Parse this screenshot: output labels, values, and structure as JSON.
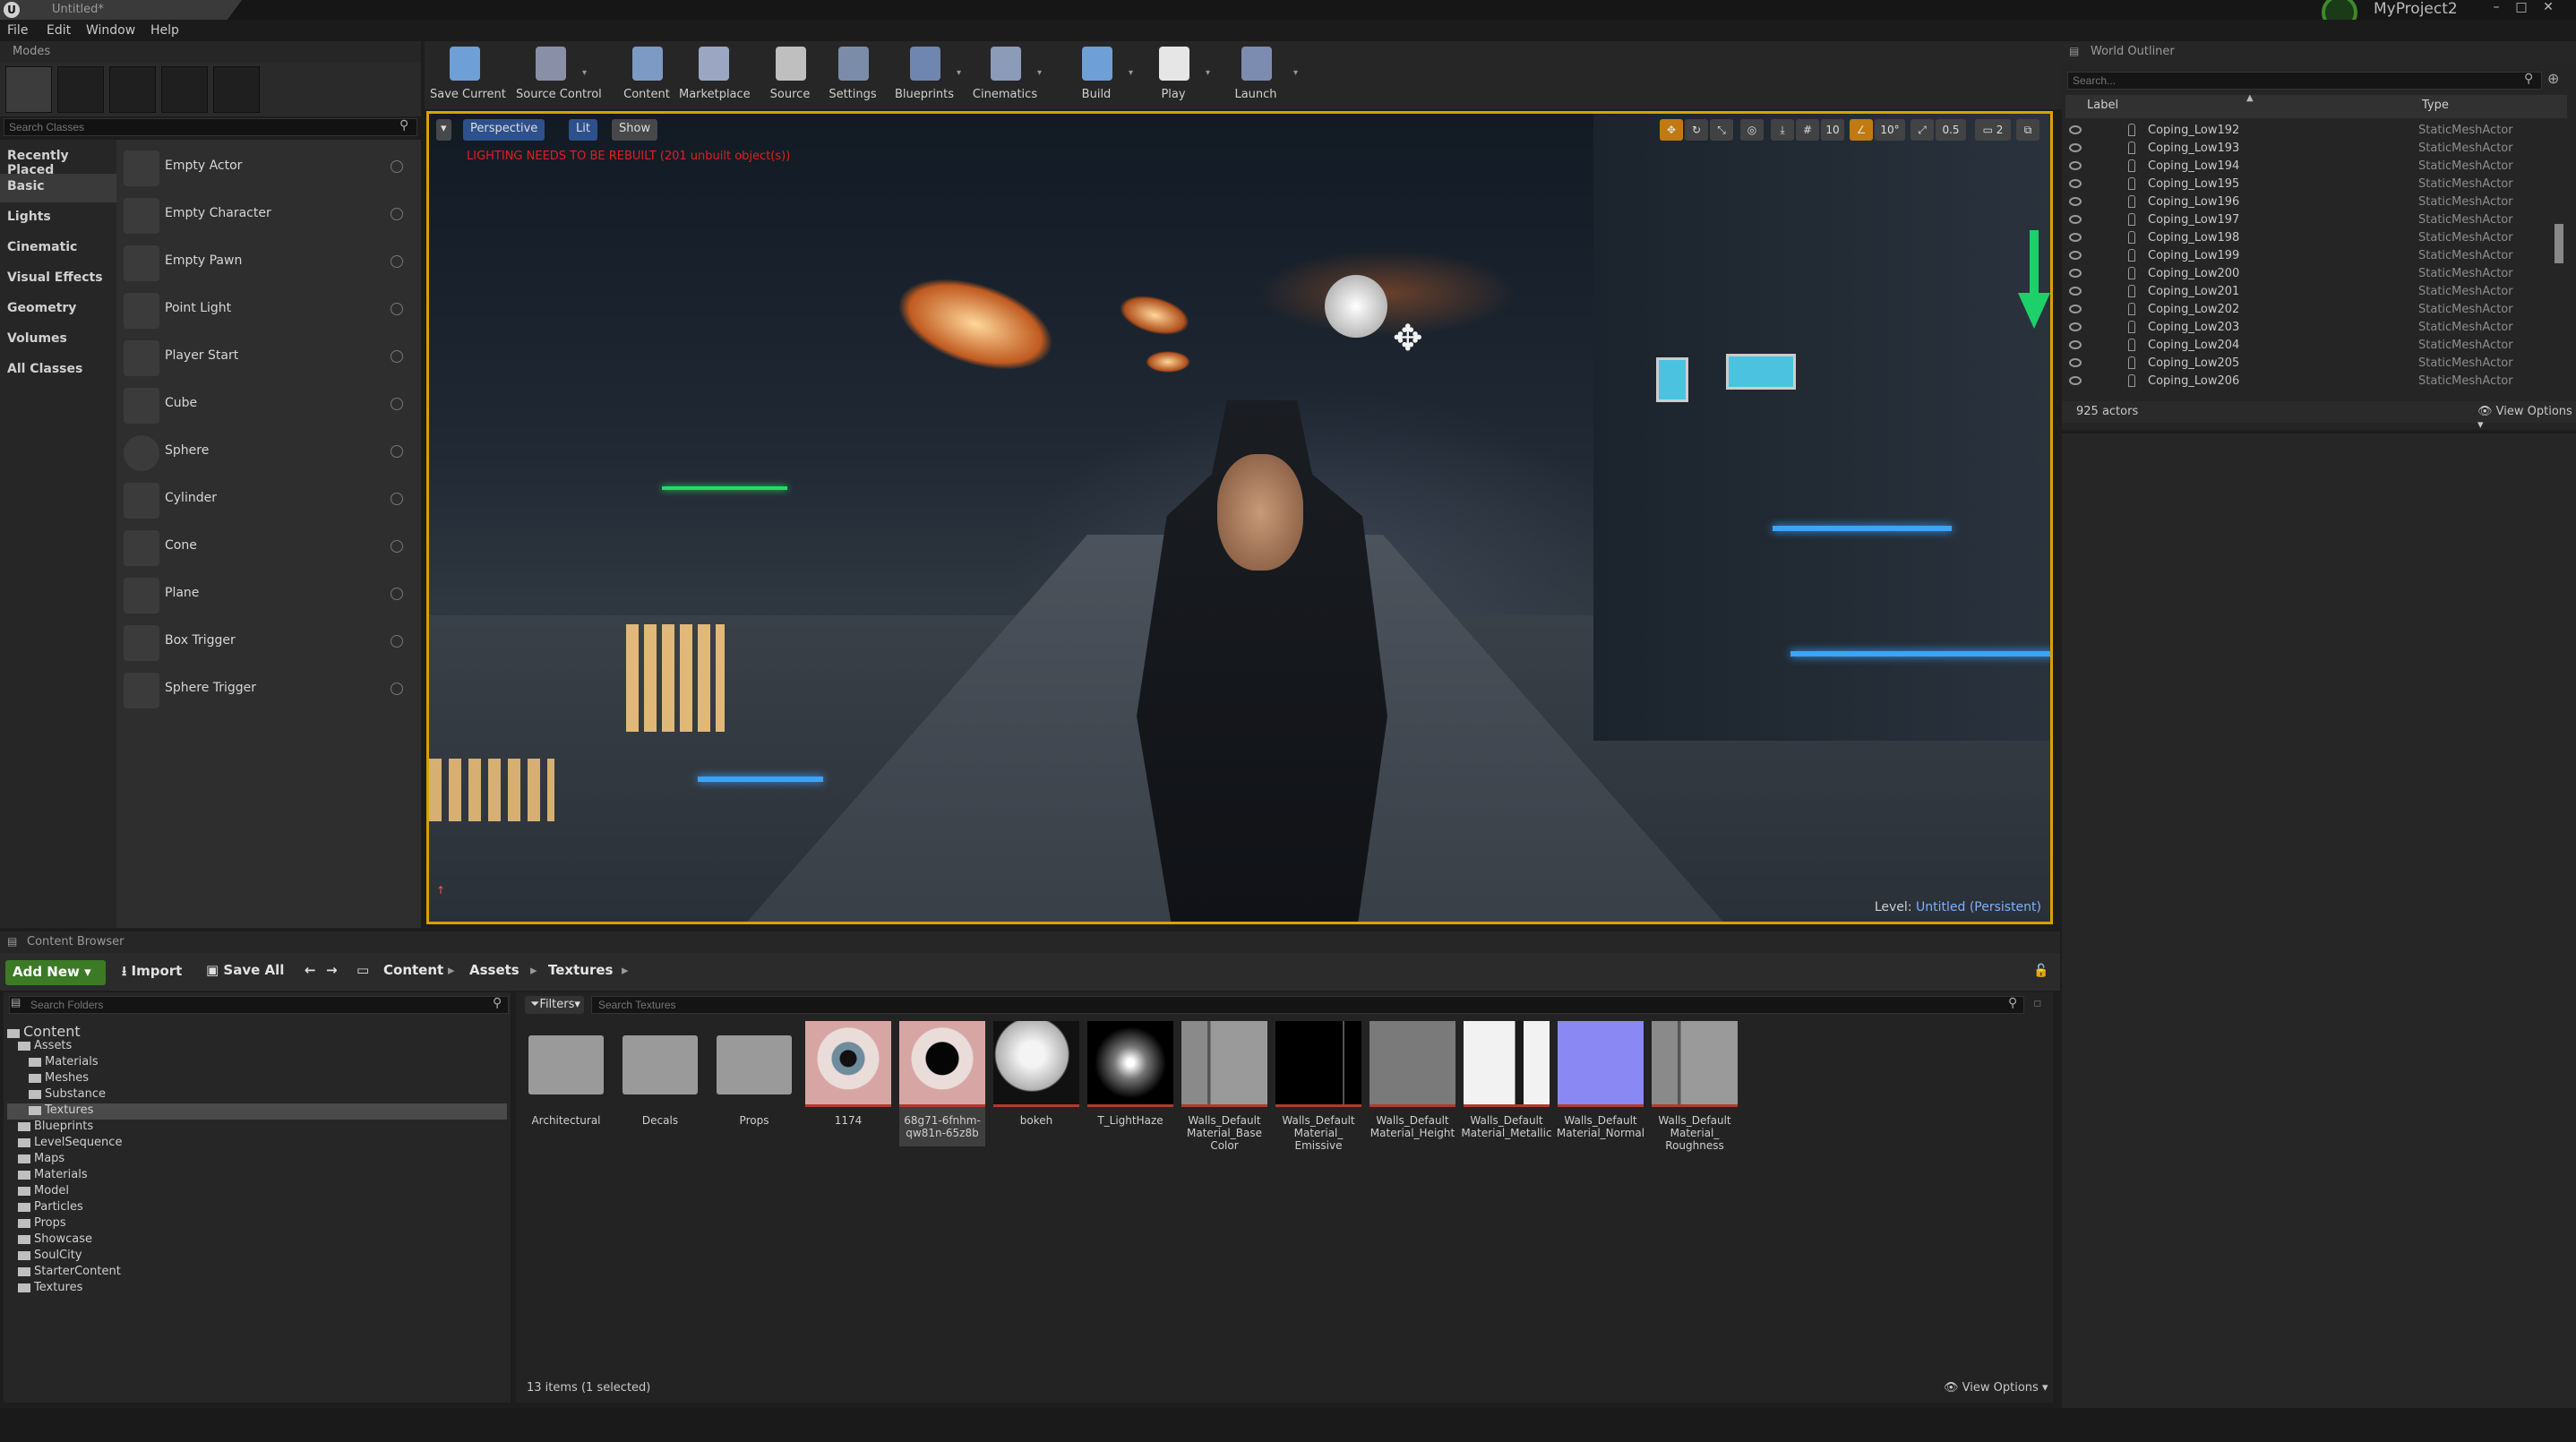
{
  "titlebar": {
    "doc_tab": "Untitled*",
    "project": "MyProject2"
  },
  "menu": [
    "File",
    "Edit",
    "Window",
    "Help"
  ],
  "modes": {
    "tab": "Modes",
    "search_placeholder": "Search Classes",
    "categories": [
      "Recently Placed",
      "Basic",
      "Lights",
      "Cinematic",
      "Visual Effects",
      "Geometry",
      "Volumes",
      "All Classes"
    ],
    "selected_category": "Basic",
    "items": [
      "Empty Actor",
      "Empty Character",
      "Empty Pawn",
      "Point Light",
      "Player Start",
      "Cube",
      "Sphere",
      "Cylinder",
      "Cone",
      "Plane",
      "Box Trigger",
      "Sphere Trigger"
    ]
  },
  "toolbar": [
    {
      "label": "Save Current",
      "icon": "save-icon",
      "color": "#6e9fd6"
    },
    {
      "label": "Source Control",
      "icon": "source-control-icon",
      "color": "#8a8fa8"
    },
    {
      "label": "Content",
      "icon": "content-icon",
      "color": "#7c9ac4"
    },
    {
      "label": "Marketplace",
      "icon": "marketplace-icon",
      "color": "#9aa6c2"
    },
    {
      "label": "Source",
      "icon": "source-icon",
      "color": "#bfbfbf"
    },
    {
      "label": "Settings",
      "icon": "settings-icon",
      "color": "#7a8ca8"
    },
    {
      "label": "Blueprints",
      "icon": "blueprints-icon",
      "color": "#6f86b0"
    },
    {
      "label": "Cinematics",
      "icon": "cinematics-icon",
      "color": "#8b9bb8"
    },
    {
      "label": "Build",
      "icon": "build-icon",
      "color": "#6e9fd6"
    },
    {
      "label": "Play",
      "icon": "play-icon",
      "color": "#e6e6e6"
    },
    {
      "label": "Launch",
      "icon": "launch-icon",
      "color": "#7c8cb0"
    }
  ],
  "viewport": {
    "perspective": "Perspective",
    "lit": "Lit",
    "show": "Show",
    "warning": "LIGHTING NEEDS TO BE REBUILT (201 unbuilt object(s))",
    "level_prefix": "Level:",
    "level_name": "Untitled (Persistent)",
    "grid_snap": "10",
    "rot_snap": "10°",
    "scale_snap": "0.5",
    "camera_speed": "2"
  },
  "outliner": {
    "tab": "World Outliner",
    "search_placeholder": "Search...",
    "col_label": "Label",
    "col_type": "Type",
    "rows": [
      {
        "label": "Coping_Low192",
        "type": "StaticMeshActor"
      },
      {
        "label": "Coping_Low193",
        "type": "StaticMeshActor"
      },
      {
        "label": "Coping_Low194",
        "type": "StaticMeshActor"
      },
      {
        "label": "Coping_Low195",
        "type": "StaticMeshActor"
      },
      {
        "label": "Coping_Low196",
        "type": "StaticMeshActor"
      },
      {
        "label": "Coping_Low197",
        "type": "StaticMeshActor"
      },
      {
        "label": "Coping_Low198",
        "type": "StaticMeshActor"
      },
      {
        "label": "Coping_Low199",
        "type": "StaticMeshActor"
      },
      {
        "label": "Coping_Low200",
        "type": "StaticMeshActor"
      },
      {
        "label": "Coping_Low201",
        "type": "StaticMeshActor"
      },
      {
        "label": "Coping_Low202",
        "type": "StaticMeshActor"
      },
      {
        "label": "Coping_Low203",
        "type": "StaticMeshActor"
      },
      {
        "label": "Coping_Low204",
        "type": "StaticMeshActor"
      },
      {
        "label": "Coping_Low205",
        "type": "StaticMeshActor"
      },
      {
        "label": "Coping_Low206",
        "type": "StaticMeshActor"
      }
    ],
    "count": "925 actors",
    "view_options": "View Options"
  },
  "content_browser": {
    "tab": "Content Browser",
    "add_new": "Add New",
    "import": "Import",
    "save_all": "Save All",
    "breadcrumb": [
      "Content",
      "Assets",
      "Textures"
    ],
    "folder_search_placeholder": "Search Folders",
    "filters": "Filters",
    "asset_search_placeholder": "Search Textures",
    "tree": [
      {
        "label": "Content",
        "indent": 0
      },
      {
        "label": "Assets",
        "indent": 1
      },
      {
        "label": "Materials",
        "indent": 2
      },
      {
        "label": "Meshes",
        "indent": 2
      },
      {
        "label": "Substance",
        "indent": 2
      },
      {
        "label": "Textures",
        "indent": 2,
        "selected": true
      },
      {
        "label": "Blueprints",
        "indent": 1
      },
      {
        "label": "LevelSequence",
        "indent": 1
      },
      {
        "label": "Maps",
        "indent": 1
      },
      {
        "label": "Materials",
        "indent": 1
      },
      {
        "label": "Model",
        "indent": 1
      },
      {
        "label": "Particles",
        "indent": 1
      },
      {
        "label": "Props",
        "indent": 1
      },
      {
        "label": "Showcase",
        "indent": 1
      },
      {
        "label": "SoulCity",
        "indent": 1
      },
      {
        "label": "StarterContent",
        "indent": 1
      },
      {
        "label": "Textures",
        "indent": 1
      }
    ],
    "assets": [
      {
        "label": "Architectural",
        "kind": "folder"
      },
      {
        "label": "Decals",
        "kind": "folder"
      },
      {
        "label": "Props",
        "kind": "folder"
      },
      {
        "label": "1174",
        "kind": "eye"
      },
      {
        "label": "68g71-6fnhm-qw81n-65z8b",
        "kind": "eye-dark",
        "selected": true
      },
      {
        "label": "bokeh",
        "kind": "sphere"
      },
      {
        "label": "T_LightHaze",
        "kind": "haze"
      },
      {
        "label": "Walls_Default Material_Base Color",
        "kind": "gray"
      },
      {
        "label": "Walls_Default Material_ Emissive",
        "kind": "black"
      },
      {
        "label": "Walls_Default Material_Height",
        "kind": "midgray"
      },
      {
        "label": "Walls_Default Material_Metallic",
        "kind": "white"
      },
      {
        "label": "Walls_Default Material_Normal",
        "kind": "normal"
      },
      {
        "label": "Walls_Default Material_ Roughness",
        "kind": "gray"
      }
    ],
    "count": "13 items (1 selected)",
    "view_options": "View Options"
  }
}
